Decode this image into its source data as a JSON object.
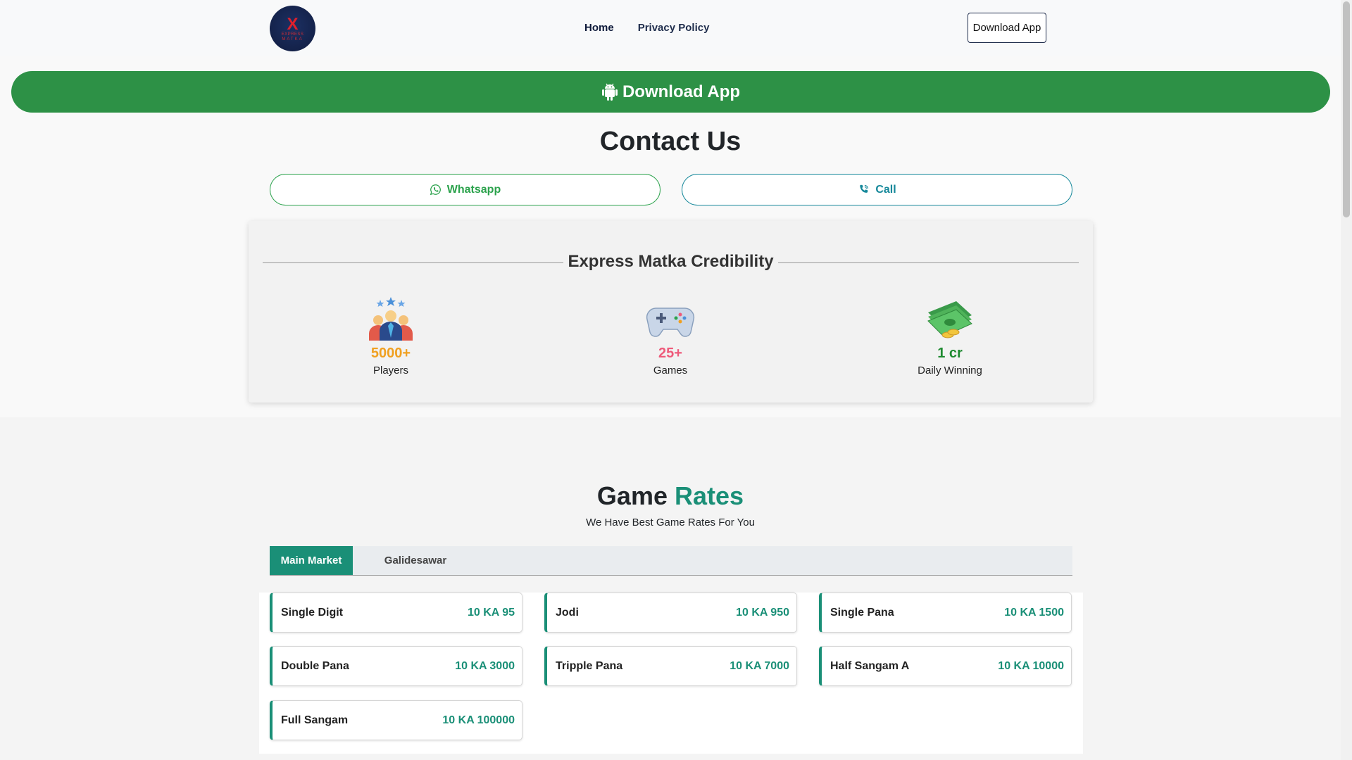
{
  "brand": {
    "logo_mark": "X",
    "logo_line1": "EXPRESS",
    "logo_line2": "MATKA"
  },
  "nav": {
    "home": "Home",
    "privacy": "Privacy Policy"
  },
  "header_button": "Download App",
  "banner": {
    "label": "Download App",
    "icon": "android-icon"
  },
  "contact": {
    "title": "Contact Us",
    "whatsapp_label": "Whatsapp",
    "call_label": "Call"
  },
  "credibility": {
    "title": "Express Matka Credibility",
    "stats": [
      {
        "value": "5000+",
        "label": "Players",
        "icon": "players-icon",
        "color": "#f0a020"
      },
      {
        "value": "25+",
        "label": "Games",
        "icon": "gamepad-icon",
        "color": "#ee5a7a"
      },
      {
        "value": "1 cr",
        "label": "Daily Winning",
        "icon": "money-icon",
        "color": "#1e8a30"
      }
    ]
  },
  "game_rates": {
    "title_part1": "Game",
    "title_part2": "Rates",
    "subtitle": "We Have Best Game Rates For You",
    "tabs": [
      "Main Market",
      "Galidesawar"
    ],
    "active_tab": "Main Market",
    "rates": [
      {
        "name": "Single Digit",
        "value": "10 KA 95"
      },
      {
        "name": "Jodi",
        "value": "10 KA 950"
      },
      {
        "name": "Single Pana",
        "value": "10 KA 1500"
      },
      {
        "name": "Double Pana",
        "value": "10 KA 3000"
      },
      {
        "name": "Tripple Pana",
        "value": "10 KA 7000"
      },
      {
        "name": "Half Sangam A",
        "value": "10 KA 10000"
      },
      {
        "name": "Full Sangam",
        "value": "10 KA 100000"
      }
    ]
  },
  "colors": {
    "green": "#2d9146",
    "teal": "#1a8f77",
    "navy": "#1f2d4c"
  }
}
